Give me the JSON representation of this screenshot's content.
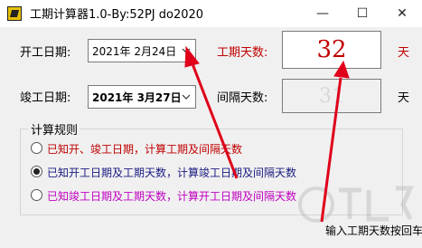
{
  "window": {
    "title": "工期计算器1.0-By:52PJ do2020",
    "minimize_glyph": "—",
    "maximize_glyph": "☐",
    "close_glyph": "✕"
  },
  "form": {
    "start_label": "开工日期:",
    "start_value": "2021年  2月24日",
    "end_label": "竣工日期:",
    "end_value": "2021年  3月27日",
    "duration_label": "工期天数:",
    "duration_value": "32",
    "duration_unit": "天",
    "interval_label": "间隔天数:",
    "interval_value": "31",
    "interval_unit": "天"
  },
  "rules": {
    "title": "计算规则",
    "options": [
      {
        "label": "已知开、竣工日期，计算工期及间隔天数",
        "color": "#c00000",
        "checked": false
      },
      {
        "label": "已知开工日期及工期天数，计算竣工日期及间隔天数",
        "color": "#1a1a80",
        "checked": true
      },
      {
        "label": "已知竣工日期及工期天数，计算开工日期及间隔天数",
        "color": "#c000c0",
        "checked": false
      }
    ]
  },
  "status_text": "输入工期天数按回车",
  "colors": {
    "accent_red": "#c00000",
    "arrow_red": "#e0001a"
  }
}
